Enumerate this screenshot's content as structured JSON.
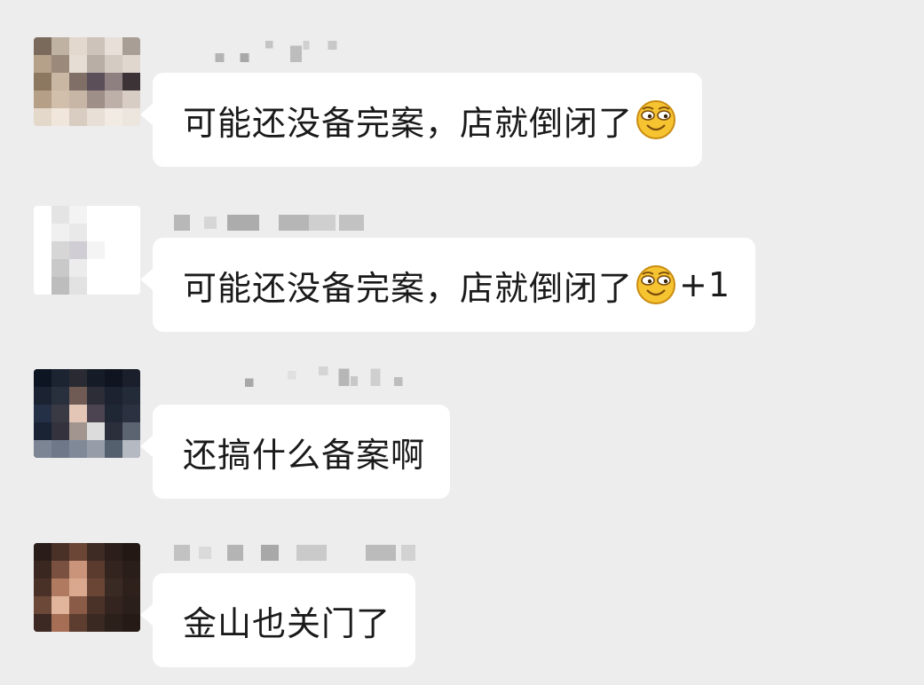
{
  "chat": {
    "messages": [
      {
        "text": "可能还没备完案，店就倒闭了",
        "emoji": "grinning-face-emoji",
        "suffix": ""
      },
      {
        "text": "可能还没备完案，店就倒闭了",
        "emoji": "grinning-face-emoji",
        "suffix": "+1"
      },
      {
        "text": "还搞什么备案啊",
        "emoji": "",
        "suffix": ""
      },
      {
        "text": "金山也关门了",
        "emoji": "",
        "suffix": ""
      }
    ]
  },
  "colors": {
    "background": "#ededed",
    "bubble": "#ffffff",
    "text": "#1a1a1a",
    "emoji_face": "#f6c331"
  }
}
